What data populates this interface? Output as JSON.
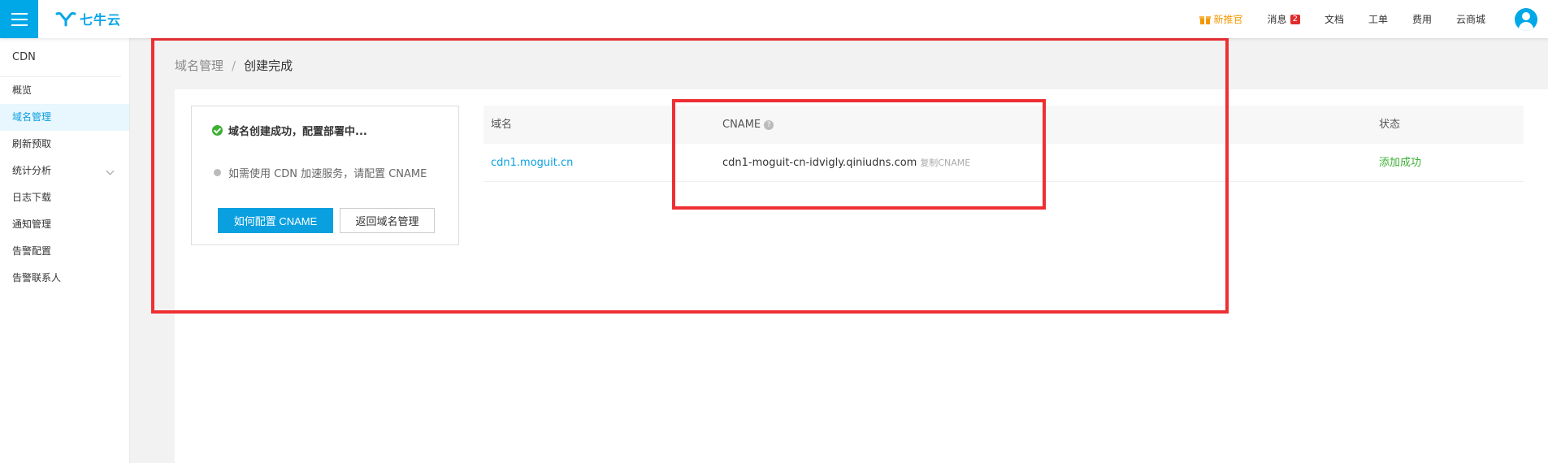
{
  "topbar": {
    "brand": "七牛云",
    "nav": {
      "promo": "新推官",
      "messages": "消息",
      "messages_count": "2",
      "docs": "文档",
      "tickets": "工单",
      "billing": "费用",
      "store": "云商城"
    }
  },
  "sidebar": {
    "title": "CDN",
    "items": [
      {
        "label": "概览"
      },
      {
        "label": "域名管理"
      },
      {
        "label": "刷新预取"
      },
      {
        "label": "统计分析"
      },
      {
        "label": "日志下载"
      },
      {
        "label": "通知管理"
      },
      {
        "label": "告警配置"
      },
      {
        "label": "告警联系人"
      }
    ]
  },
  "breadcrumb": {
    "parent": "域名管理",
    "separator": "/",
    "current": "创建完成"
  },
  "status": {
    "success_text": "域名创建成功，配置部署中...",
    "hint_text": "如需使用 CDN 加速服务，请配置 CNAME",
    "primary_button": "如何配置 CNAME",
    "secondary_button": "返回域名管理"
  },
  "table": {
    "headers": {
      "domain": "域名",
      "cname": "CNAME",
      "cname_help": "?",
      "status": "状态"
    },
    "rows": [
      {
        "domain": "cdn1.moguit.cn",
        "cname": "cdn1-moguit-cn-idvigly.qiniudns.com",
        "copy_label": "复制CNAME",
        "status": "添加成功"
      }
    ]
  },
  "colors": {
    "accent": "#0aa0e0",
    "success": "#3cb034",
    "annotation": "#ee3033",
    "promo": "#f39800"
  }
}
